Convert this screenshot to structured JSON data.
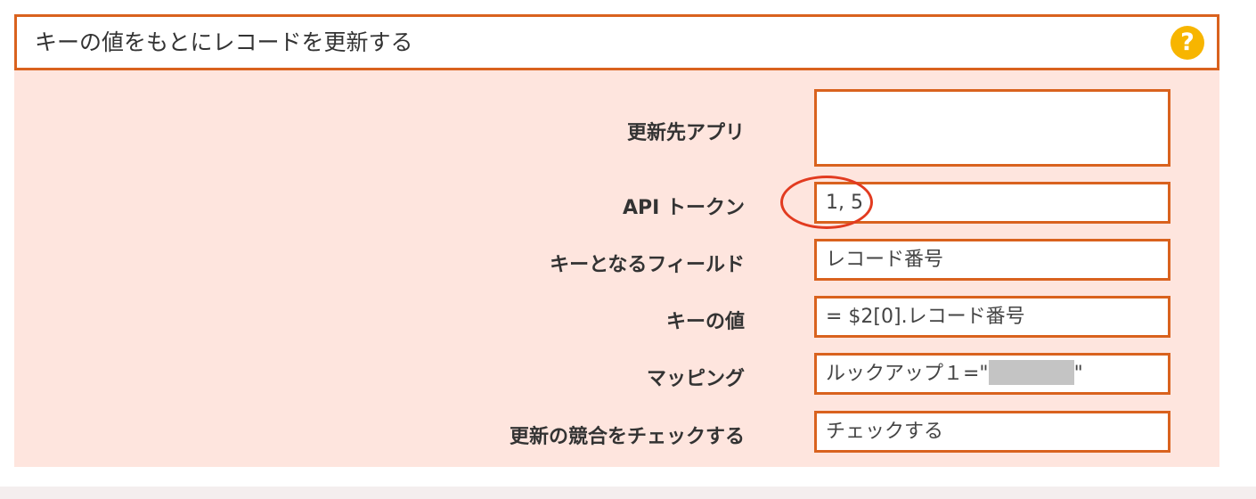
{
  "header": {
    "title": "キーの値をもとにレコードを更新する",
    "help_icon": "?"
  },
  "rows": [
    {
      "label": "更新先アプリ",
      "value": ""
    },
    {
      "label": "API トークン",
      "value": "1, 5"
    },
    {
      "label": "キーとなるフィールド",
      "value": "レコード番号"
    },
    {
      "label": "キーの値",
      "value": "= $2[0].レコード番号"
    },
    {
      "label": "マッピング",
      "value_prefix": "ルックアップ１=\"",
      "value_suffix": "\"",
      "value_redacted": true
    },
    {
      "label": "更新の競合をチェックする",
      "value": "チェックする"
    }
  ],
  "colors": {
    "accent_border": "#d9621e",
    "panel_bg": "#fee5de",
    "help_icon": "#f7b500",
    "annotation": "#e23b20"
  }
}
